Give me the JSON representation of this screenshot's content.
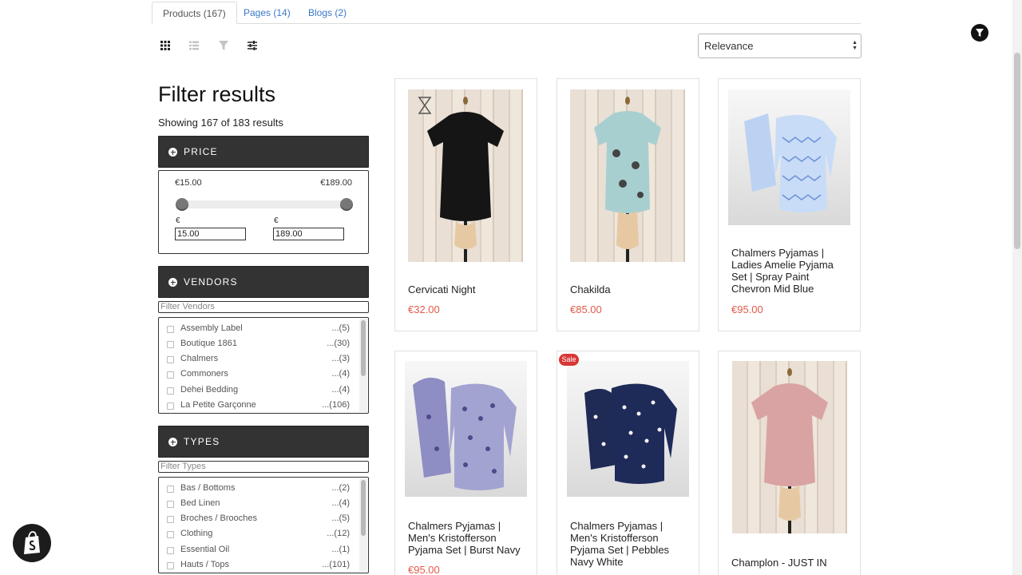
{
  "tabs": [
    {
      "label": "Products (167)",
      "active": true
    },
    {
      "label": "Pages (14)",
      "active": false
    },
    {
      "label": "Blogs (2)",
      "active": false
    }
  ],
  "toolbar": {
    "icons": [
      "grid-view-icon",
      "list-view-icon",
      "filter-funnel-icon",
      "sliders-icon"
    ],
    "sort": {
      "selected": "Relevance"
    }
  },
  "sidebar": {
    "title": "Filter results",
    "showing": "Showing 167 of 183 results",
    "price": {
      "header": "PRICE",
      "min_display": "€15.00",
      "max_display": "€189.00",
      "currency_symbol": "€",
      "min_value": "15.00",
      "max_value": "189.00"
    },
    "vendors": {
      "header": "VENDORS",
      "filter_placeholder": "Filter Vendors",
      "items": [
        {
          "name": "Assembly Label",
          "count": "...(5)"
        },
        {
          "name": "Boutique 1861",
          "count": "...(30)"
        },
        {
          "name": "Chalmers",
          "count": "...(3)"
        },
        {
          "name": "Commoners",
          "count": "...(4)"
        },
        {
          "name": "Dehei Bedding",
          "count": "...(4)"
        },
        {
          "name": "La Petite Garçonne",
          "count": "...(106)"
        }
      ]
    },
    "types": {
      "header": "TYPES",
      "filter_placeholder": "Filter Types",
      "items": [
        {
          "name": "Bas / Bottoms",
          "count": "...(2)"
        },
        {
          "name": "Bed Linen",
          "count": "...(4)"
        },
        {
          "name": "Broches / Brooches",
          "count": "...(5)"
        },
        {
          "name": "Clothing",
          "count": "...(12)"
        },
        {
          "name": "Essential Oil",
          "count": "...(1)"
        },
        {
          "name": "Hauts / Tops",
          "count": "...(101)"
        }
      ]
    }
  },
  "products": [
    {
      "name": "Cervicati Night",
      "price": "€32.00"
    },
    {
      "name": "Chakilda",
      "price": "€85.00"
    },
    {
      "name": "Chalmers Pyjamas | Ladies Amelie Pyjama Set | Spray Paint Chevron Mid Blue",
      "price": "€95.00"
    },
    {
      "name": "Chalmers Pyjamas | Men's Kristofferson Pyjama Set | Burst Navy",
      "price": "€95.00"
    },
    {
      "name": "Chalmers Pyjamas | Men's Kristofferson Pyjama Set | Pebbles Navy White",
      "price": ""
    },
    {
      "name": "Champlon - JUST IN",
      "price": ""
    }
  ],
  "badges": {
    "sale": "Sale"
  },
  "colors": {
    "accent_link": "#3a78c9",
    "price": "#e05a4a",
    "section_header": "#333333",
    "sale_badge": "#d93636"
  }
}
